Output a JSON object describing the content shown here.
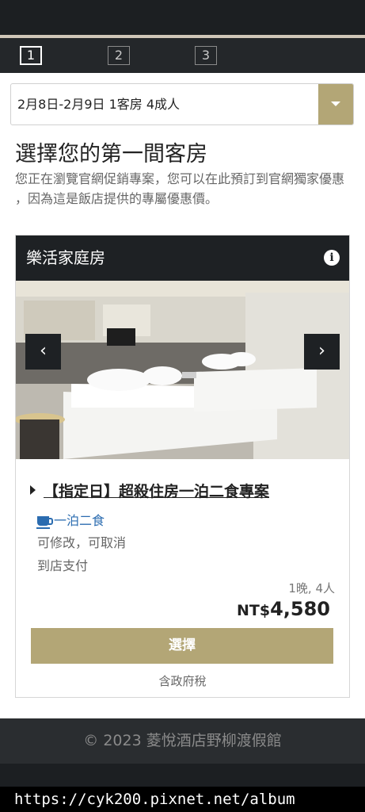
{
  "steps": [
    "1",
    "2",
    "3"
  ],
  "search": {
    "summary": "2月8日-2月9日  1客房 4成人",
    "dropdown_icon": "chevron-down-icon"
  },
  "page": {
    "title": "選擇您的第一間客房",
    "description": "您正在瀏覽官網促銷專案，您可以在此預訂到官網獨家優惠 ，因為這是飯店提供的專屬優惠價。"
  },
  "room": {
    "name": "樂活家庭房",
    "info_icon": "info-icon",
    "prev_label": "‹",
    "next_label": "›",
    "plan": {
      "title": "【指定日】超殺住房一泊二食專案",
      "meal": "一泊二食",
      "policy": "可修改，可取消",
      "payment": "到店支付",
      "per": "1晚, 4人",
      "currency": "NT$",
      "amount": "4,580",
      "select_label": "選擇",
      "tax_note": "含政府稅"
    }
  },
  "footer": {
    "copyright": "© 2023 菱悅酒店野柳渡假館"
  },
  "watermark": "https://cyk200.pixnet.net/album",
  "colors": {
    "accent": "#b3a676",
    "dark": "#1e2124",
    "link": "#2b6cb0"
  }
}
